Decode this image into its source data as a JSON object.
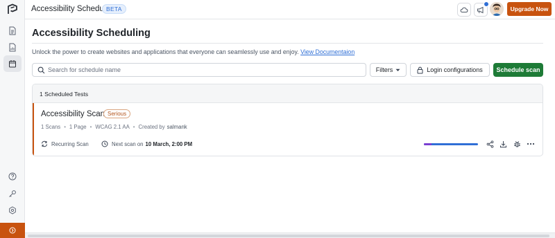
{
  "topbar": {
    "app_title": "Accessibility Scheduling",
    "badge": "BETA",
    "upgrade_label": "Upgrade Now"
  },
  "main": {
    "title": "Accessibility Scheduling",
    "intro_text": "Unlock the power to create websites and applications that everyone can seamlessly use and enjoy.",
    "intro_link": "View Documentaion",
    "search_placeholder": "Search for schedule name",
    "filters_label": "Filters",
    "login_label": "Login configurations",
    "schedule_label": "Schedule scan"
  },
  "panel": {
    "header": "1 Scheduled Tests",
    "card": {
      "title": "Accessibility Scans",
      "severity": "Serious",
      "scans": "1 Scans",
      "pages": "1 Page",
      "standard": "WCAG 2.1 AA",
      "created_prefix": "Created by",
      "creator": "salmank",
      "recurring": "Recurring Scan",
      "next_prefix": "Next scan on",
      "next_date": "10 March, 2:00 PM",
      "progress_fraction": 0.14
    }
  },
  "colors": {
    "accent": "#c8530f",
    "primary_green": "#1e7b37",
    "link_blue": "#2f6fd6",
    "progress_purple": "#7a3fd1"
  },
  "icons": {
    "rail": [
      "app-logo-icon",
      "document-icon",
      "report-icon",
      "calendar-icon",
      "help-icon",
      "key-icon",
      "settings-icon",
      "collapse-icon"
    ],
    "topbar": [
      "cloud-icon",
      "megaphone-icon"
    ],
    "actions": [
      "share-icon",
      "download-icon",
      "bug-icon",
      "more-icon"
    ]
  }
}
